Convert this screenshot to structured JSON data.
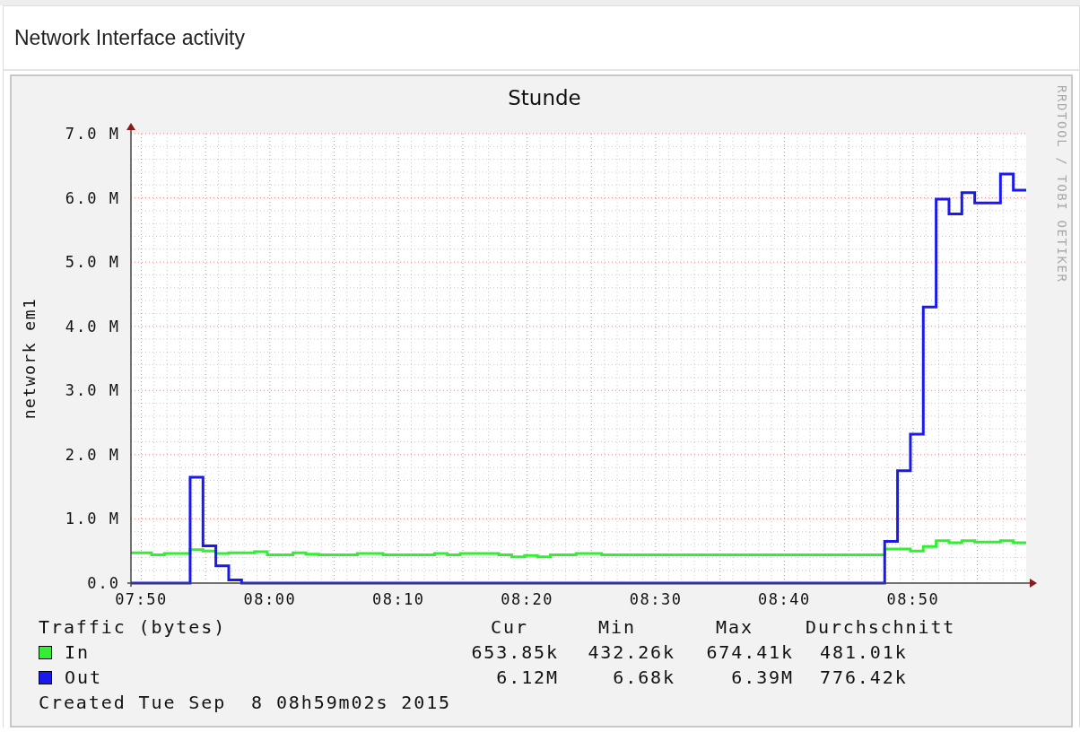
{
  "panel": {
    "title": "Network Interface activity"
  },
  "graph": {
    "watermark": "RRDTOOL / TOBI OETIKER",
    "chart_data": {
      "type": "line",
      "title": "Stunde",
      "ylabel": "network em1",
      "grid": true,
      "xlim": [
        469.2,
        538.8
      ],
      "ylim": [
        0,
        7
      ],
      "xticks": [
        {
          "value": 470,
          "label": "07:50"
        },
        {
          "value": 480,
          "label": "08:00"
        },
        {
          "value": 490,
          "label": "08:10"
        },
        {
          "value": 500,
          "label": "08:20"
        },
        {
          "value": 510,
          "label": "08:30"
        },
        {
          "value": 520,
          "label": "08:40"
        },
        {
          "value": 530,
          "label": "08:50"
        }
      ],
      "yticks": [
        {
          "value": 0,
          "label": "0.0"
        },
        {
          "value": 1,
          "label": "1.0 M"
        },
        {
          "value": 2,
          "label": "2.0 M"
        },
        {
          "value": 3,
          "label": "3.0 M"
        },
        {
          "value": 4,
          "label": "4.0 M"
        },
        {
          "value": 5,
          "label": "5.0 M"
        },
        {
          "value": 6,
          "label": "6.0 M"
        },
        {
          "value": 7,
          "label": "7.0 M"
        }
      ],
      "x": [
        469.2,
        470.8,
        470.8,
        471.8,
        471.8,
        472.8,
        472.8,
        473.8,
        473.8,
        474.8,
        474.8,
        475.8,
        475.8,
        476.8,
        476.8,
        477.8,
        477.8,
        478.8,
        478.8,
        479.8,
        479.8,
        480.8,
        480.8,
        481.8,
        481.8,
        482.8,
        482.8,
        483.8,
        483.8,
        484.8,
        484.8,
        485.8,
        485.8,
        486.8,
        486.8,
        487.8,
        487.8,
        488.8,
        488.8,
        489.8,
        489.8,
        490.8,
        490.8,
        491.8,
        491.8,
        492.8,
        492.8,
        493.8,
        493.8,
        494.8,
        494.8,
        495.8,
        495.8,
        496.8,
        496.8,
        497.8,
        497.8,
        498.8,
        498.8,
        499.8,
        499.8,
        500.8,
        500.8,
        501.8,
        501.8,
        502.8,
        502.8,
        503.8,
        503.8,
        504.8,
        504.8,
        505.8,
        505.8,
        506.8,
        506.8,
        507.8,
        507.8,
        508.8,
        508.8,
        509.8,
        509.8,
        510.8,
        510.8,
        511.8,
        511.8,
        512.8,
        512.8,
        513.8,
        513.8,
        514.8,
        514.8,
        515.8,
        515.8,
        516.8,
        516.8,
        517.8,
        517.8,
        518.8,
        518.8,
        519.8,
        519.8,
        520.8,
        520.8,
        521.8,
        521.8,
        522.8,
        522.8,
        523.8,
        523.8,
        524.8,
        524.8,
        525.8,
        525.8,
        526.8,
        526.8,
        527.8,
        527.8,
        528.8,
        528.8,
        529.8,
        529.8,
        530.8,
        530.8,
        531.8,
        531.8,
        532.8,
        532.8,
        533.8,
        533.8,
        534.8,
        534.8,
        535.8,
        535.8,
        536.8,
        536.8,
        537.8,
        537.8,
        538.8
      ],
      "series": [
        {
          "name": "In",
          "color": "#33ee33",
          "values": [
            0.47,
            0.47,
            0.44,
            0.44,
            0.46,
            0.46,
            0.46,
            0.46,
            0.52,
            0.52,
            0.5,
            0.5,
            0.46,
            0.46,
            0.47,
            0.47,
            0.47,
            0.47,
            0.49,
            0.49,
            0.44,
            0.44,
            0.44,
            0.44,
            0.47,
            0.47,
            0.45,
            0.45,
            0.44,
            0.44,
            0.44,
            0.44,
            0.44,
            0.44,
            0.46,
            0.46,
            0.46,
            0.46,
            0.44,
            0.44,
            0.44,
            0.44,
            0.44,
            0.44,
            0.44,
            0.44,
            0.46,
            0.46,
            0.44,
            0.44,
            0.46,
            0.46,
            0.46,
            0.46,
            0.46,
            0.46,
            0.44,
            0.44,
            0.41,
            0.41,
            0.43,
            0.43,
            0.41,
            0.41,
            0.44,
            0.44,
            0.44,
            0.44,
            0.46,
            0.46,
            0.46,
            0.46,
            0.44,
            0.44,
            0.44,
            0.44,
            0.44,
            0.44,
            0.44,
            0.44,
            0.44,
            0.44,
            0.44,
            0.44,
            0.44,
            0.44,
            0.44,
            0.44,
            0.44,
            0.44,
            0.44,
            0.44,
            0.44,
            0.44,
            0.44,
            0.44,
            0.44,
            0.44,
            0.44,
            0.44,
            0.44,
            0.44,
            0.44,
            0.44,
            0.44,
            0.44,
            0.44,
            0.44,
            0.44,
            0.44,
            0.44,
            0.44,
            0.44,
            0.44,
            0.44,
            0.44,
            0.53,
            0.53,
            0.53,
            0.53,
            0.5,
            0.5,
            0.57,
            0.57,
            0.66,
            0.66,
            0.63,
            0.63,
            0.66,
            0.66,
            0.64,
            0.64,
            0.64,
            0.64,
            0.66,
            0.66,
            0.63,
            0.63
          ]
        },
        {
          "name": "Out",
          "color": "#1a1aee",
          "values": [
            0,
            0,
            0,
            0,
            0,
            0,
            0,
            0,
            1.65,
            1.65,
            0.58,
            0.58,
            0.27,
            0.27,
            0.05,
            0.05,
            0,
            0,
            0,
            0,
            0,
            0,
            0,
            0,
            0,
            0,
            0,
            0,
            0,
            0,
            0,
            0,
            0,
            0,
            0,
            0,
            0,
            0,
            0,
            0,
            0,
            0,
            0,
            0,
            0,
            0,
            0,
            0,
            0,
            0,
            0,
            0,
            0,
            0,
            0,
            0,
            0,
            0,
            0,
            0,
            0,
            0,
            0,
            0,
            0,
            0,
            0,
            0,
            0,
            0,
            0,
            0,
            0,
            0,
            0,
            0,
            0,
            0,
            0,
            0,
            0,
            0,
            0,
            0,
            0,
            0,
            0,
            0,
            0,
            0,
            0,
            0,
            0,
            0,
            0,
            0,
            0,
            0,
            0,
            0,
            0,
            0,
            0,
            0,
            0,
            0,
            0,
            0,
            0,
            0,
            0,
            0,
            0,
            0,
            0,
            0,
            0.65,
            0.65,
            1.75,
            1.75,
            2.32,
            2.32,
            4.3,
            4.3,
            5.98,
            5.98,
            5.75,
            5.75,
            6.08,
            6.08,
            5.92,
            5.92,
            5.92,
            5.92,
            6.37,
            6.37,
            6.12,
            6.12
          ]
        }
      ]
    }
  },
  "legend": {
    "heading": "Traffic (bytes)",
    "columns": [
      "Cur",
      "Min",
      "Max",
      "Durchschnitt"
    ],
    "rows": [
      {
        "values": [
          "653.85k",
          "432.26k",
          "674.41k",
          "481.01k"
        ]
      },
      {
        "values": [
          "6.12M",
          "6.68k",
          "6.39M",
          "776.42k"
        ]
      }
    ]
  },
  "created": "Created Tue Sep  8 08h59m02s 2015"
}
